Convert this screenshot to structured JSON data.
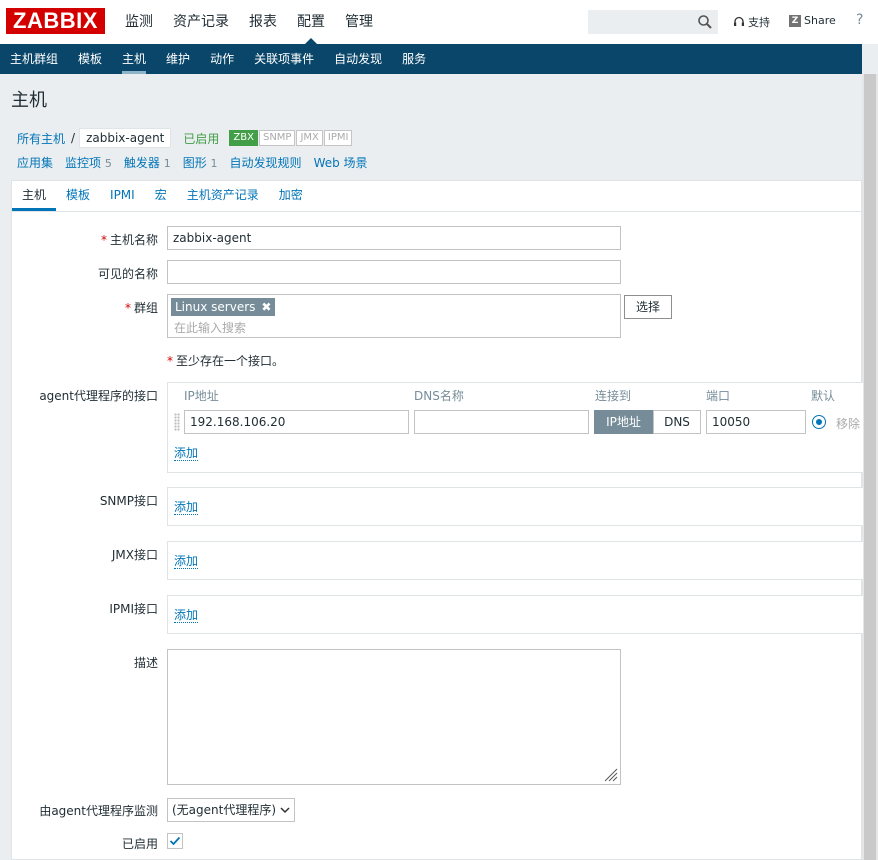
{
  "header": {
    "logo": "ZABBIX",
    "menu": [
      "监测",
      "资产记录",
      "报表",
      "配置",
      "管理"
    ],
    "support_label": "支持",
    "share_label": "Share",
    "help_label": "?"
  },
  "submenu": [
    "主机群组",
    "模板",
    "主机",
    "维护",
    "动作",
    "关联项事件",
    "自动发现",
    "服务"
  ],
  "page": {
    "title": "主机"
  },
  "breadcrumb": {
    "all_hosts": "所有主机",
    "separator": "/",
    "current": "zabbix-agent",
    "status": "已启用",
    "availability": [
      "ZBX",
      "SNMP",
      "JMX",
      "IPMI"
    ]
  },
  "sublinks": [
    {
      "label": "应用集",
      "count": ""
    },
    {
      "label": "监控项",
      "count": "5"
    },
    {
      "label": "触发器",
      "count": "1"
    },
    {
      "label": "图形",
      "count": "1"
    },
    {
      "label": "自动发现规则",
      "count": ""
    },
    {
      "label": "Web 场景",
      "count": ""
    }
  ],
  "tabs": [
    "主机",
    "模板",
    "IPMI",
    "宏",
    "主机资产记录",
    "加密"
  ],
  "form": {
    "host_name_label": "主机名称",
    "host_name_value": "zabbix-agent",
    "visible_name_label": "可见的名称",
    "visible_name_value": "",
    "groups_label": "群组",
    "group_chip": "Linux servers",
    "group_remove": "✖",
    "groups_placeholder": "在此输入搜索",
    "select_button": "选择",
    "req_mark": "*",
    "interface_note": "至少存在一个接口。",
    "agent_iface_label": "agent代理程序的接口",
    "col_ip": "IP地址",
    "col_dns": "DNS名称",
    "col_connect": "连接到",
    "col_port": "端口",
    "col_default": "默认",
    "ip_value": "192.168.106.20",
    "dns_value": "",
    "connect_ip": "IP地址",
    "connect_dns": "DNS",
    "port_value": "10050",
    "remove_label": "移除",
    "add_label": "添加",
    "snmp_label": "SNMP接口",
    "jmx_label": "JMX接口",
    "ipmi_label": "IPMI接口",
    "description_label": "描述",
    "monitored_by_label": "由agent代理程序监测",
    "monitored_by_value": "(无agent代理程序)",
    "enabled_label": "已启用",
    "enabled_checked": true
  },
  "colors": {
    "logo_red": "#d40000",
    "nav_blue": "#0a466a",
    "link_blue": "#0275b8",
    "status_green": "#429e47"
  }
}
